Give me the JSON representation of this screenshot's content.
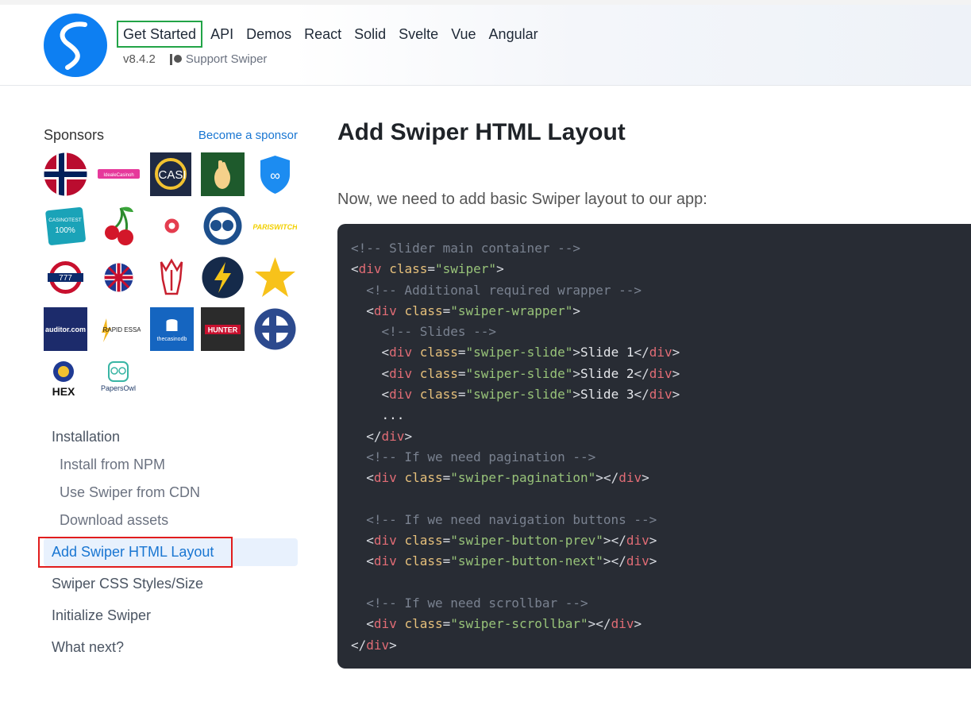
{
  "header": {
    "nav": [
      "Get Started",
      "API",
      "Demos",
      "React",
      "Solid",
      "Svelte",
      "Vue",
      "Angular"
    ],
    "version": "v8.4.2",
    "support_label": "Support Swiper"
  },
  "sidebar": {
    "sponsors_title": "Sponsors",
    "become_sponsor": "Become a sponsor",
    "sponsor_logos": [
      {
        "label": ""
      },
      {
        "label": "IdealeCasinoh"
      },
      {
        "label": "CASI"
      },
      {
        "label": ""
      },
      {
        "label": ""
      },
      {
        "label": "CASINOTEST"
      },
      {
        "label": ""
      },
      {
        "label": ""
      },
      {
        "label": ""
      },
      {
        "label": "PARISWITCH"
      },
      {
        "label": "777"
      },
      {
        "label": ""
      },
      {
        "label": ""
      },
      {
        "label": ""
      },
      {
        "label": ""
      },
      {
        "label": "auditor.com"
      },
      {
        "label": "RAPID ESSAY"
      },
      {
        "label": "thecasinodb"
      },
      {
        "label": "HUNTER"
      },
      {
        "label": ""
      },
      {
        "label": "HEX"
      },
      {
        "label": "PapersOwl"
      }
    ],
    "menu": [
      {
        "label": "Installation",
        "level": 0
      },
      {
        "label": "Install from NPM",
        "level": 1
      },
      {
        "label": "Use Swiper from CDN",
        "level": 1
      },
      {
        "label": "Download assets",
        "level": 1
      },
      {
        "label": "Add Swiper HTML Layout",
        "level": 0,
        "active": true
      },
      {
        "label": "Swiper CSS Styles/Size",
        "level": 0
      },
      {
        "label": "Initialize Swiper",
        "level": 0
      },
      {
        "label": "What next?",
        "level": 0
      }
    ]
  },
  "main": {
    "title": "Add Swiper HTML Layout",
    "intro": "Now, we need to add basic Swiper layout to our app:",
    "code_lines": [
      "<!-- Slider main container -->",
      "<div class=\"swiper\">",
      "  <!-- Additional required wrapper -->",
      "  <div class=\"swiper-wrapper\">",
      "    <!-- Slides -->",
      "    <div class=\"swiper-slide\">Slide 1</div>",
      "    <div class=\"swiper-slide\">Slide 2</div>",
      "    <div class=\"swiper-slide\">Slide 3</div>",
      "    ...",
      "  </div>",
      "  <!-- If we need pagination -->",
      "  <div class=\"swiper-pagination\"></div>",
      "",
      "  <!-- If we need navigation buttons -->",
      "  <div class=\"swiper-button-prev\"></div>",
      "  <div class=\"swiper-button-next\"></div>",
      "",
      "  <!-- If we need scrollbar -->",
      "  <div class=\"swiper-scrollbar\"></div>",
      "</div>"
    ]
  },
  "colors": {
    "accent": "#1976d2",
    "highlight_green": "#22a447",
    "highlight_red": "#e11d1d",
    "code_bg": "#282c34"
  }
}
